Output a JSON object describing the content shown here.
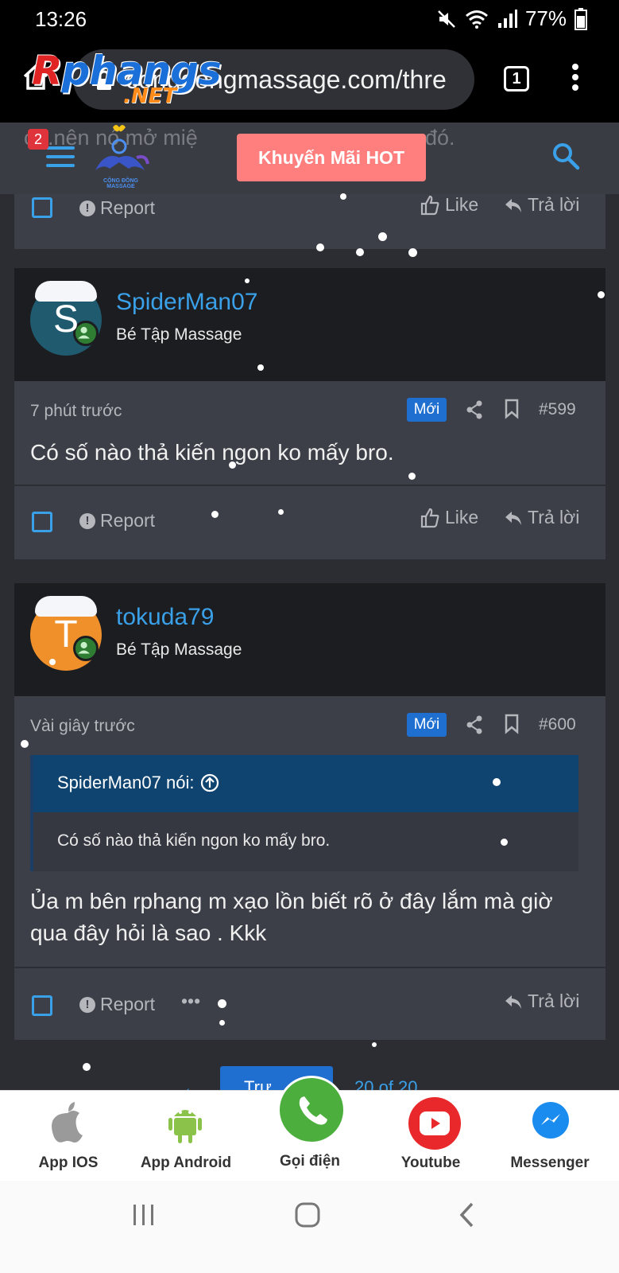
{
  "status_bar": {
    "time": "13:26",
    "battery": "77%"
  },
  "browser": {
    "url": "congdongmassage.com/thre",
    "tab_count": "1"
  },
  "watermark": {
    "main": "Rphangs",
    "sub": ".NET"
  },
  "forum_header": {
    "notification_count": "2",
    "promo_label": "Khuyến Mãi HOT",
    "faded_text_left": "ó...nên nó mở miệ",
    "faded_text_right": "đó.",
    "logo_caption": "CỘNG ĐỒNG MASSAGE"
  },
  "top_actions": {
    "report": "Report",
    "like": "Like",
    "reply": "Trả lời"
  },
  "posts": [
    {
      "username": "SpiderMan07",
      "user_title": "Bé Tập Massage",
      "avatar_letter": "S",
      "avatar_color": "#1f5a6e",
      "time": "7 phút trước",
      "new_badge": "Mới",
      "number": "#599",
      "body": "Có số nào thả kiến ngon ko mấy bro.",
      "report": "Report",
      "like": "Like",
      "reply": "Trả lời"
    },
    {
      "username": "tokuda79",
      "user_title": "Bé Tập Massage",
      "avatar_letter": "T",
      "avatar_color": "#f0902a",
      "time": "Vài giây trước",
      "new_badge": "Mới",
      "number": "#600",
      "quote_author": "SpiderMan07 nói:",
      "quote_text": "Có số nào thả kiến ngon ko mấy bro.",
      "body_line1": "Ủa m bên rphang m xạo lồn biết rõ ở đây lắm mà giờ",
      "body_line2": "qua đây hỏi là sao . Kkk",
      "report": "Report",
      "more": "•••",
      "reply": "Trả lời"
    }
  ],
  "pagination": {
    "prev": "Trư",
    "info": "20 of 20"
  },
  "app_bar": {
    "items": [
      {
        "label": "App IOS",
        "icon": "apple-icon"
      },
      {
        "label": "App Android",
        "icon": "android-icon"
      },
      {
        "label": "Gọi điện",
        "icon": "phone-icon"
      },
      {
        "label": "Youtube",
        "icon": "youtube-icon"
      },
      {
        "label": "Messenger",
        "icon": "messenger-icon"
      }
    ]
  },
  "colors": {
    "accent": "#3aa0e8",
    "badge": "#1f6fd0",
    "promo": "#ff7f7f",
    "call": "#4caf3d"
  }
}
